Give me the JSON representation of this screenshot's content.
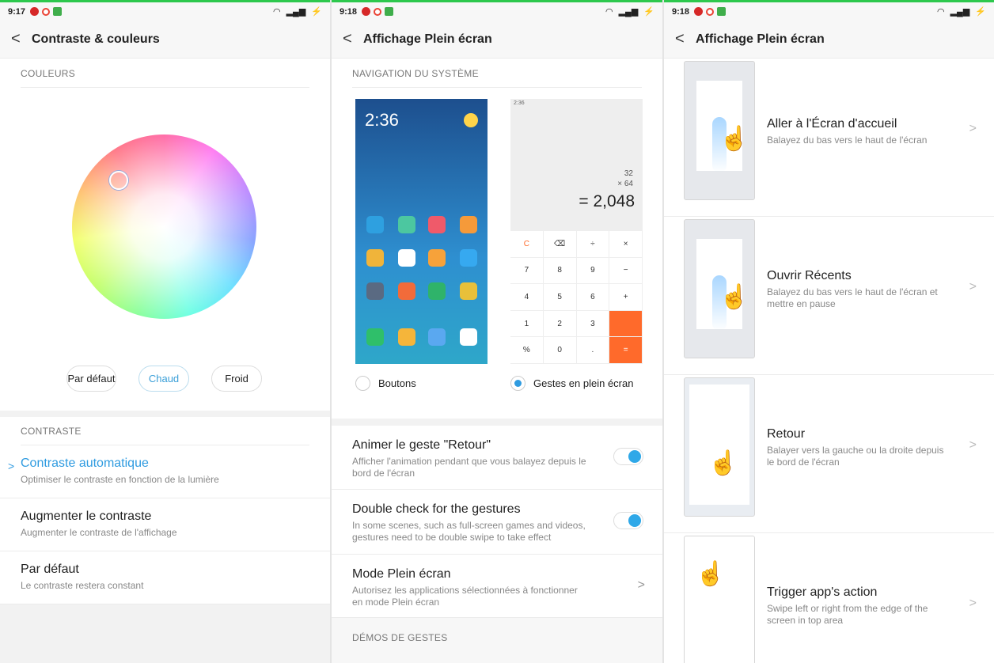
{
  "panel1": {
    "status": {
      "time": "9:17"
    },
    "header": {
      "title": "Contraste & couleurs",
      "back": "<"
    },
    "colors_section": "COULEURS",
    "buttons": [
      "Par défaut",
      "Chaud",
      "Froid"
    ],
    "contrast_section": "CONTRASTE",
    "rows": [
      {
        "title": "Contraste automatique",
        "sub": "Optimiser le contraste en fonction de la lumière"
      },
      {
        "title": "Augmenter le contraste",
        "sub": "Augmenter le contraste de l'affichage"
      },
      {
        "title": "Par défaut",
        "sub": "Le contraste restera constant"
      }
    ],
    "selected_arrow": ">"
  },
  "panel2": {
    "status": {
      "time": "9:18"
    },
    "header": {
      "title": "Affichage Plein écran",
      "back": "<"
    },
    "nav_section": "NAVIGATION DU SYSTÈME",
    "phone1_clock": "2:36",
    "phone2": {
      "small_time": "2:36",
      "line1": "32",
      "line2": "× 64",
      "result": "= 2,048",
      "keys": [
        "C",
        "⌫",
        "÷",
        "×",
        "7",
        "8",
        "9",
        "−",
        "4",
        "5",
        "6",
        "+",
        "1",
        "2",
        "3",
        "",
        "%",
        "0",
        ".",
        "="
      ]
    },
    "radio_buttons": "Boutons",
    "radio_gestures": "Gestes en plein écran",
    "rows": [
      {
        "title": "Animer le geste \"Retour\"",
        "sub": "Afficher l'animation pendant que vous balayez depuis le bord de l'écran"
      },
      {
        "title": "Double check for the gestures",
        "sub": "In some scenes, such as full-screen games and videos, gestures need to be double swipe to take effect"
      },
      {
        "title": "Mode Plein écran",
        "sub": "Autorisez les applications sélectionnées à fonctionner en mode Plein écran"
      }
    ],
    "demo_section": "DÉMOS DE GESTES",
    "chevron": ">"
  },
  "panel3": {
    "status": {
      "time": "9:18"
    },
    "header": {
      "title": "Affichage Plein écran",
      "back": "<"
    },
    "gestures": [
      {
        "title": "Aller à l'Écran d'accueil",
        "sub": "Balayez du bas vers le haut de l'écran"
      },
      {
        "title": "Ouvrir Récents",
        "sub": "Balayez du bas vers le haut de l'écran et mettre en pause"
      },
      {
        "title": "Retour",
        "sub": "Balayer vers la gauche ou la droite depuis le bord de l'écran"
      },
      {
        "title": "Trigger app's action",
        "sub": "Swipe left or right from the edge of the screen in top area"
      }
    ],
    "chevron": ">"
  },
  "colors": {
    "accent": "#2f9be0",
    "toggle": "#2fa8e8",
    "status_green": "#2dc84d",
    "calc_orange": "#ff6a2b"
  }
}
